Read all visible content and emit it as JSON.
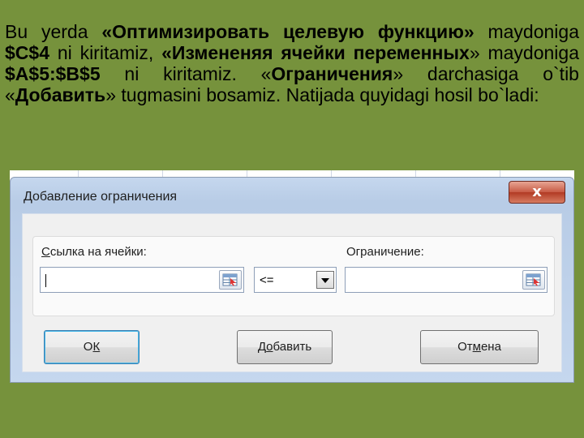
{
  "instruction": {
    "p1": "Bu yerda ",
    "b1": "«Оптимизировать целевую функцию»",
    "p2": " maydoniga ",
    "b2": "$C$4",
    "p3": " ni kiritamiz, ",
    "b3": "«Измененяя ячейки переменных",
    "p4": "» maydoniga ",
    "b4": "$A$5:$B$5",
    "p5": " ni kiritamiz. «",
    "b5": "Ограничения",
    "p6": "» darchasiga o`tib «",
    "b6": "Добавить",
    "p7": "» tugmasini bosamiz. Natijada  quyidagi hosil bo`ladi:"
  },
  "dialog": {
    "title": "Добавление ограничения",
    "close_glyph": "x",
    "cell_ref_label_first": "С",
    "cell_ref_label_rest": "сылка на ячейки:",
    "cell_ref_value": "",
    "operator_value": "<=",
    "constraint_label": "Ограничение:",
    "constraint_value": "",
    "ok_first": "О",
    "ok_rest": "К",
    "add_first": "Д",
    "add_underlined": "о",
    "add_rest": "бавить",
    "cancel_first": "От",
    "cancel_underlined": "м",
    "cancel_rest": "ена"
  },
  "colors": {
    "slide_background": "#76923c",
    "dialog_frame": "#c5d7ee",
    "close_button": "#c75a44"
  },
  "icons": {
    "ref_button": "range-select-icon",
    "dropdown": "chevron-down-icon",
    "close": "close-icon"
  }
}
